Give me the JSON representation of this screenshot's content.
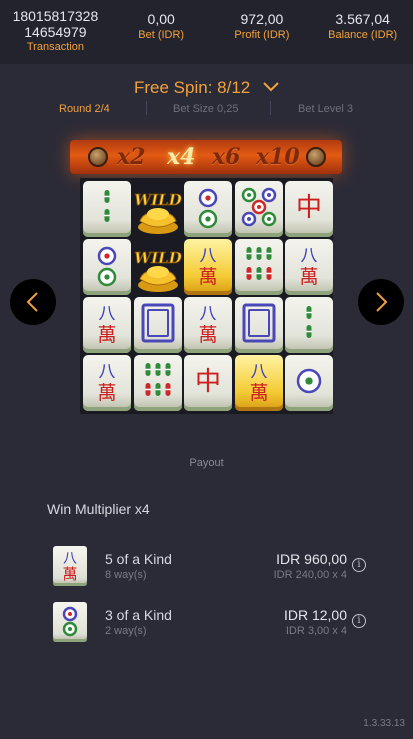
{
  "stats": {
    "transaction_line1": "18015817328",
    "transaction_line2": "14654979",
    "transaction_label": "Transaction",
    "bet_value": "0,00",
    "bet_label": "Bet (IDR)",
    "profit_value": "972,00",
    "profit_label": "Profit (IDR)",
    "balance_value": "3.567,04",
    "balance_label": "Balance (IDR)"
  },
  "free_spin": {
    "label": "Free Spin: 8/12"
  },
  "sub_info": {
    "round": "Round 2/4",
    "bet_size": "Bet Size 0,25",
    "bet_level": "Bet Level 3"
  },
  "multipliers": {
    "values": [
      "x2",
      "x4",
      "x6",
      "x10"
    ],
    "active": "x4"
  },
  "reels": {
    "rows": [
      [
        "bamboo-2",
        "wild",
        "dots-2",
        "dots-5",
        "red-dragon"
      ],
      [
        "dots-2",
        "wild",
        "character-8-gold",
        "bamboo-6",
        "character-8"
      ],
      [
        "character-8",
        "white-dragon",
        "character-8",
        "white-dragon",
        "bamboo-2"
      ],
      [
        "character-8",
        "bamboo-6",
        "red-dragon",
        "character-8-gold",
        "dots-1"
      ]
    ],
    "wild_label": "WILD"
  },
  "payout": {
    "title": "Payout",
    "win_multiplier": "Win Multiplier x4",
    "rows": [
      {
        "icon": "character-8",
        "kind": "5 of a Kind",
        "ways": "8 way(s)",
        "amount": "IDR 960,00",
        "calc": "IDR 240,00 x 4"
      },
      {
        "icon": "dots-2",
        "kind": "3 of a Kind",
        "ways": "2 way(s)",
        "amount": "IDR 12,00",
        "calc": "IDR 3,00 x 4"
      }
    ]
  },
  "glyphs": {
    "eight": "八",
    "wan": "萬",
    "zhong": "中",
    "info": "i"
  },
  "colors": {
    "accent": "#f2a23a",
    "background": "#2b2b38",
    "topbar": "#23232e",
    "multiplier_bar": "#e35a13"
  },
  "version": "1.3.33.13"
}
